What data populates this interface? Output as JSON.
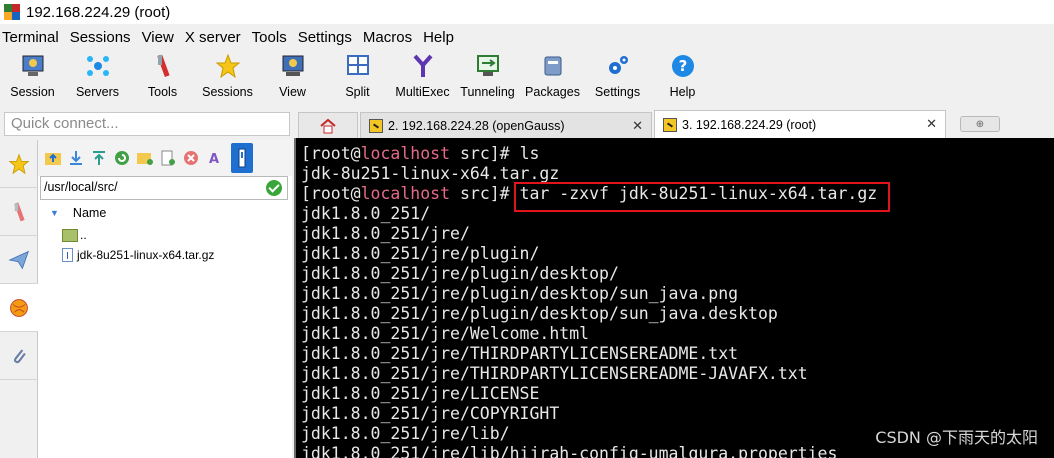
{
  "window": {
    "title": "192.168.224.29 (root)"
  },
  "menu": [
    "Terminal",
    "Sessions",
    "View",
    "X server",
    "Tools",
    "Settings",
    "Macros",
    "Help"
  ],
  "toolbar": [
    {
      "label": "Session",
      "icon": "session-icon"
    },
    {
      "label": "Servers",
      "icon": "servers-icon"
    },
    {
      "label": "Tools",
      "icon": "tools-icon"
    },
    {
      "label": "Sessions",
      "icon": "star-icon"
    },
    {
      "label": "View",
      "icon": "view-icon"
    },
    {
      "label": "Split",
      "icon": "split-icon"
    },
    {
      "label": "MultiExec",
      "icon": "multiexec-icon"
    },
    {
      "label": "Tunneling",
      "icon": "tunneling-icon"
    },
    {
      "label": "Packages",
      "icon": "packages-icon"
    },
    {
      "label": "Settings",
      "icon": "settings-icon"
    },
    {
      "label": "Help",
      "icon": "help-icon"
    }
  ],
  "quick_connect": {
    "placeholder": "Quick connect..."
  },
  "tabs": [
    {
      "label": "2. 192.168.224.28 (openGauss)",
      "active": false
    },
    {
      "label": "3. 192.168.224.29 (root)",
      "active": true
    }
  ],
  "sftp": {
    "path": "/usr/local/src/",
    "column": "Name",
    "files": [
      {
        "name": "..",
        "type": "folder"
      },
      {
        "name": "jdk-8u251-linux-x64.tar.gz",
        "type": "file"
      }
    ]
  },
  "terminal": {
    "prompt_user": "[root@",
    "prompt_host": "localhost",
    "prompt_dir": " src]# ",
    "cmd1": "ls",
    "out1": "jdk-8u251-linux-x64.tar.gz",
    "cmd2": "tar -zxvf jdk-8u251-linux-x64.tar.gz",
    "output": [
      "jdk1.8.0_251/",
      "jdk1.8.0_251/jre/",
      "jdk1.8.0_251/jre/plugin/",
      "jdk1.8.0_251/jre/plugin/desktop/",
      "jdk1.8.0_251/jre/plugin/desktop/sun_java.png",
      "jdk1.8.0_251/jre/plugin/desktop/sun_java.desktop",
      "jdk1.8.0_251/jre/Welcome.html",
      "jdk1.8.0_251/jre/THIRDPARTYLICENSEREADME.txt",
      "jdk1.8.0_251/jre/THIRDPARTYLICENSEREADME-JAVAFX.txt",
      "jdk1.8.0_251/jre/LICENSE",
      "jdk1.8.0_251/jre/COPYRIGHT",
      "jdk1.8.0_251/jre/lib/",
      "jdk1.8.0_251/jre/lib/hijrah-config-umalqura.properties"
    ]
  },
  "watermark": "CSDN @下雨天的太阳",
  "colors": {
    "host": "#e46a8a",
    "highlight": "#e0141a",
    "terminal_bg": "#000000"
  }
}
